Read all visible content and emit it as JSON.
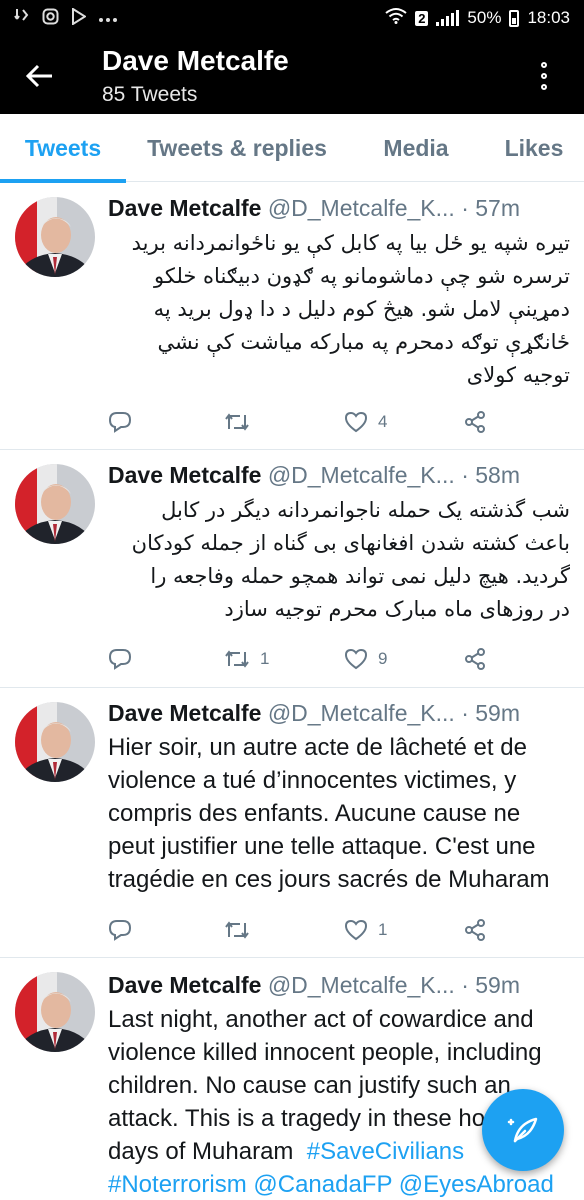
{
  "status_bar": {
    "battery": "50%",
    "time": "18:03",
    "sim_badge": "2",
    "notification_icons": [
      "missed-call-icon",
      "instagram-icon",
      "play-store-icon",
      "more-notifications-icon"
    ]
  },
  "header": {
    "title": "Dave Metcalfe",
    "subtitle": "85 Tweets"
  },
  "tabs": [
    {
      "label": "Tweets",
      "active": true
    },
    {
      "label": "Tweets & replies",
      "active": false
    },
    {
      "label": "Media",
      "active": false
    },
    {
      "label": "Likes",
      "active": false
    }
  ],
  "colors": {
    "accent": "#1da1f2",
    "secondary_text": "#657786",
    "header_bg": "#000000"
  },
  "tweets": [
    {
      "name": "Dave Metcalfe",
      "handle": "@D_Metcalfe_K...",
      "time": "· 57m",
      "lang": "rtl",
      "lines": [
        "تیره شپه یو ځل بیا په کابل کې یو ناځوانمردانه برید",
        "ترسره شو چې دماشومانو په ګډون دبیګناه خلکو",
        "دمړینې لامل شو. هیڅ کوم دلیل  د دا ډول برید په",
        "ځانګړې توګه دمحرم په مبارکه میاشت کې نشي",
        "توجیه کولای"
      ],
      "replies": "",
      "retweets": "",
      "likes": "4"
    },
    {
      "name": "Dave Metcalfe",
      "handle": "@D_Metcalfe_K...",
      "time": "· 58m",
      "lang": "rtl",
      "lines": [
        "شب گذشته یک حمله ناجوانمردانه دیگر  در کابل",
        "باعث کشته شدن افغانهای بی گناه از جمله کودکان",
        "گردید. هیچ دلیل نمی تواند همچو حمله وفاجعه را",
        "در روزهای ماه  مبارک محرم توجیه سازد"
      ],
      "replies": "",
      "retweets": "1",
      "likes": "9"
    },
    {
      "name": "Dave Metcalfe",
      "handle": "@D_Metcalfe_K...",
      "time": "· 59m",
      "lang": "ltr",
      "lines": [
        "Hier soir, un autre acte de lâcheté et de",
        "violence a tué d’innocentes victimes, y",
        "compris des enfants. Aucune cause  ne",
        "peut justifier une telle attaque. C'est une",
        "tragédie en ces jours sacrés de Muharam"
      ],
      "replies": "",
      "retweets": "",
      "likes": "1"
    },
    {
      "name": "Dave Metcalfe",
      "handle": "@D_Metcalfe_K...",
      "time": "· 59m",
      "lang": "ltr",
      "lines": [
        "Last night, another act of cowardice and",
        "violence killed innocent people, including",
        "children. No cause can justify such an",
        "attack. This is a tragedy in these ho"
      ],
      "last_line_text": "days of Muharam  ",
      "hashtag_1": "#SaveCivilians",
      "hashtag_2": "#Noterrorism",
      "mention_1": "@CanadaFP",
      "mention_2": "@EyesAbroad"
    }
  ]
}
